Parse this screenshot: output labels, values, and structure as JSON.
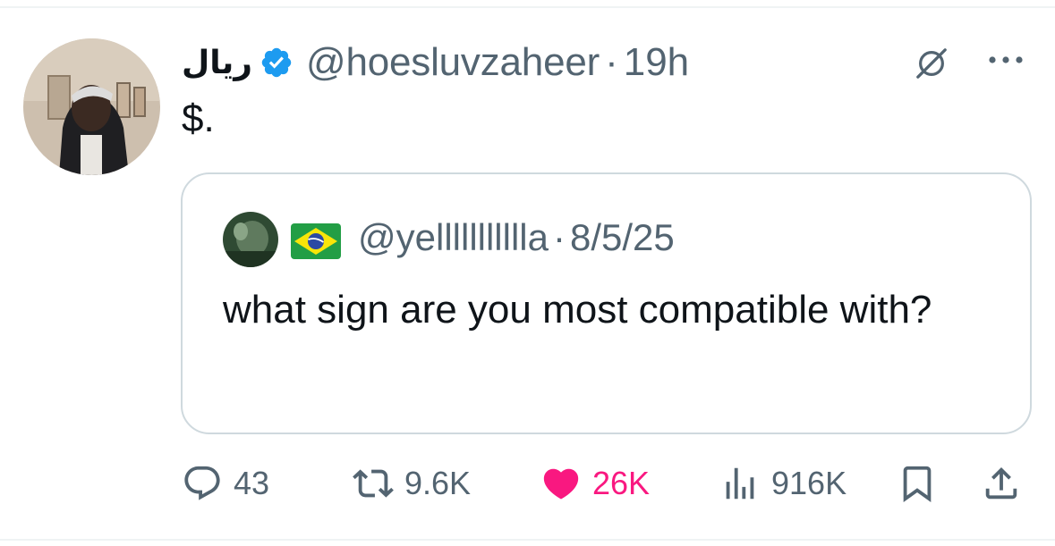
{
  "tweet": {
    "display_name": "ريال",
    "handle": "@hoesluvzaheer",
    "separator": "·",
    "time": "19h",
    "text": "$.",
    "verified": true
  },
  "quote": {
    "handle": "@yellllllllllla",
    "separator": "·",
    "time": "8/5/25",
    "text": "what sign are you most compatible with?",
    "flag_icon": "brazil-flag-icon"
  },
  "actions": {
    "reply_count": "43",
    "retweet_count": "9.6K",
    "like_count": "26K",
    "views_count": "916K"
  },
  "colors": {
    "verified_blue": "#1d9bf0",
    "like_pink": "#f91880",
    "secondary_text": "#536471",
    "border": "#cfd9de"
  }
}
